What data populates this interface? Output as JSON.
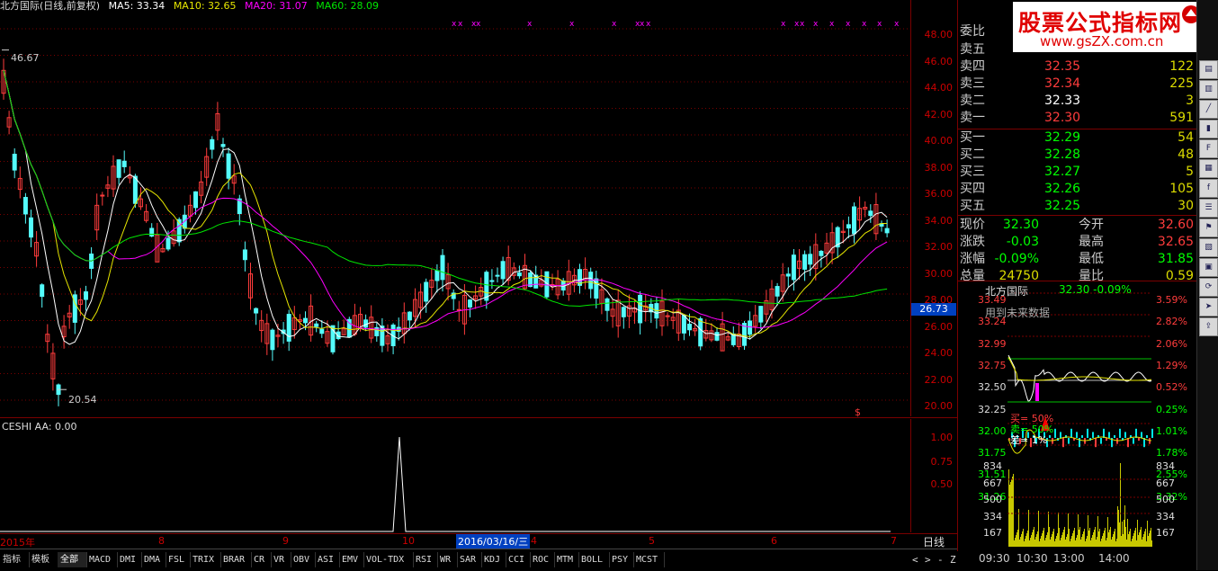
{
  "header": {
    "title": "北方国际(日线,前复权)",
    "ma5": "MA5: 33.34",
    "ma10": "MA10: 32.65",
    "ma20": "MA20: 31.07",
    "ma60": "MA60: 28.09"
  },
  "colors": {
    "up": "#ff3c3c",
    "down": "#54fcfc",
    "ma5": "#ffffff",
    "ma10": "#e6e600",
    "ma20": "#ff00ff",
    "ma60": "#00e600",
    "axis": "#cc0000"
  },
  "price_axis": [
    "48.00",
    "46.00",
    "44.00",
    "42.00",
    "40.00",
    "38.00",
    "36.00",
    "34.00",
    "32.00",
    "30.00",
    "28.00",
    "26.00",
    "24.00",
    "22.00",
    "20.00"
  ],
  "current_price_tag": "26.73",
  "high_label": "46.67",
  "low_label": "20.54",
  "signal_marker": "$",
  "sub": {
    "title": "CESHI AA: 0.00",
    "axis": [
      "1.00",
      "0.75",
      "0.50"
    ]
  },
  "dates": {
    "labels": [
      "2015年",
      "8",
      "9",
      "10",
      "2016/03/16/三",
      "4",
      "5",
      "6",
      "7"
    ],
    "period": "日线"
  },
  "tabs": [
    "指标",
    "模板",
    "全部",
    "MACD",
    "DMI",
    "DMA",
    "FSL",
    "TRIX",
    "BRAR",
    "CR",
    "VR",
    "OBV",
    "ASI",
    "EMV",
    "VOL-TDX",
    "RSI",
    "WR",
    "SAR",
    "KDJ",
    "CCI",
    "ROC",
    "MTM",
    "BOLL",
    "PSY",
    "MCST"
  ],
  "tab_nav": [
    "<",
    ">",
    "-",
    "Z"
  ],
  "quote": {
    "webi_label": "委比",
    "asks": [
      {
        "label": "卖五",
        "price": "",
        "vol": ""
      },
      {
        "label": "卖四",
        "price": "32.35",
        "vol": "122"
      },
      {
        "label": "卖三",
        "price": "32.34",
        "vol": "225"
      },
      {
        "label": "卖二",
        "price": "32.33",
        "vol": "3"
      },
      {
        "label": "卖一",
        "price": "32.30",
        "vol": "591"
      }
    ],
    "bids": [
      {
        "label": "买一",
        "price": "32.29",
        "vol": "54"
      },
      {
        "label": "买二",
        "price": "32.28",
        "vol": "48"
      },
      {
        "label": "买三",
        "price": "32.27",
        "vol": "5"
      },
      {
        "label": "买四",
        "price": "32.26",
        "vol": "105"
      },
      {
        "label": "买五",
        "price": "32.25",
        "vol": "30"
      }
    ],
    "stats": [
      {
        "l1": "现价",
        "v1": "32.30",
        "l2": "今开",
        "v2": "32.60"
      },
      {
        "l1": "涨跌",
        "v1": "-0.03",
        "l2": "最高",
        "v2": "32.65"
      },
      {
        "l1": "涨幅",
        "v1": "-0.09%",
        "l2": "最低",
        "v2": "31.85"
      },
      {
        "l1": "总量",
        "v1": "24750",
        "l2": "量比",
        "v2": "0.59"
      }
    ]
  },
  "mini": {
    "name": "北方国际",
    "quote": "32.30 -0.09%",
    "notice": "用到未来数据",
    "left_axis": [
      "33.49",
      "33.24",
      "32.99",
      "32.75",
      "32.50",
      "32.25",
      "32.00",
      "31.75",
      "31.51",
      "31.26"
    ],
    "right_axis": [
      "3.59%",
      "2.82%",
      "2.06%",
      "1.29%",
      "0.52%",
      "0.25%",
      "1.01%",
      "1.78%",
      "2.55%",
      "3.32%"
    ],
    "vol_axis_left": [
      "834",
      "667",
      "500",
      "334",
      "167"
    ],
    "vol_axis_right": [
      "834",
      "667",
      "500",
      "334",
      "167"
    ],
    "overlay": [
      "买= 50%",
      "卖= 50%",
      "差= 1%"
    ],
    "times": [
      "09:30",
      "10:30",
      "13:00",
      "14:00"
    ]
  },
  "watermark": {
    "title": "股票公式指标网",
    "url": "www.gsZX.com.cn"
  },
  "toolbar_icons": [
    "ad-icon",
    "chart-icon",
    "line-icon",
    "bar-icon",
    "f10-icon",
    "grid-icon",
    "f-icon",
    "list-icon",
    "flag-icon",
    "chart2-icon",
    "report-icon",
    "refresh-icon",
    "arrow-icon",
    "export-icon"
  ]
}
